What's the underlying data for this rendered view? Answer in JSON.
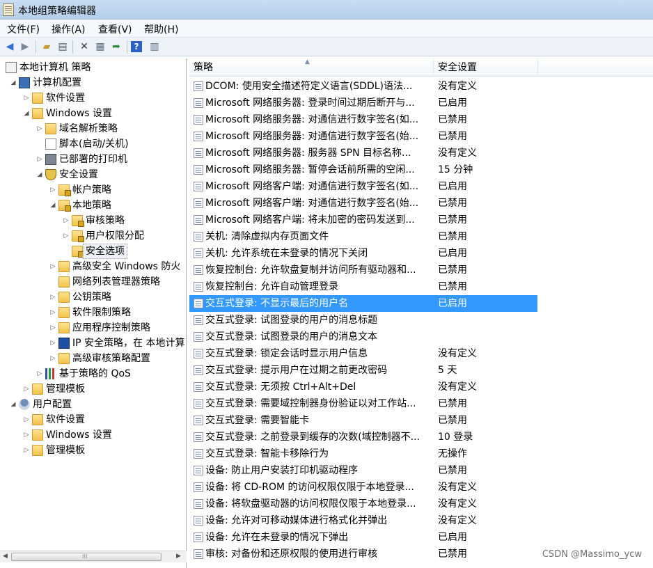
{
  "window": {
    "title": "本地组策略编辑器"
  },
  "menu": [
    "文件(F)",
    "操作(A)",
    "查看(V)",
    "帮助(H)"
  ],
  "toolbar": [
    "back-icon",
    "forward-icon",
    "up-folder-icon",
    "show-hide-tree-icon",
    "delete-icon",
    "properties-icon",
    "export-icon",
    "help-icon",
    "view-icon"
  ],
  "tree": [
    {
      "label": "本地计算机 策略",
      "icon": "root",
      "indent": 0,
      "exp": ""
    },
    {
      "label": "计算机配置",
      "icon": "pc",
      "indent": 1,
      "exp": "◢"
    },
    {
      "label": "软件设置",
      "icon": "folder",
      "indent": 2,
      "exp": "▷"
    },
    {
      "label": "Windows 设置",
      "icon": "folder",
      "indent": 2,
      "exp": "◢"
    },
    {
      "label": "域名解析策略",
      "icon": "folder",
      "indent": 3,
      "exp": "▷"
    },
    {
      "label": "脚本(启动/关机)",
      "icon": "doc",
      "indent": 3,
      "exp": ""
    },
    {
      "label": "已部署的打印机",
      "icon": "printer",
      "indent": 3,
      "exp": "▷"
    },
    {
      "label": "安全设置",
      "icon": "shield",
      "indent": 3,
      "exp": "◢"
    },
    {
      "label": "帐户策略",
      "icon": "folder-lock",
      "indent": 4,
      "exp": "▷"
    },
    {
      "label": "本地策略",
      "icon": "folder-lock",
      "indent": 4,
      "exp": "◢"
    },
    {
      "label": "审核策略",
      "icon": "folder-lock",
      "indent": 5,
      "exp": "▷"
    },
    {
      "label": "用户权限分配",
      "icon": "folder-lock",
      "indent": 5,
      "exp": "▷"
    },
    {
      "label": "安全选项",
      "icon": "folder-lock",
      "indent": 5,
      "exp": "",
      "selected": true
    },
    {
      "label": "高级安全 Windows 防火",
      "icon": "folder",
      "indent": 4,
      "exp": "▷"
    },
    {
      "label": "网络列表管理器策略",
      "icon": "folder",
      "indent": 4,
      "exp": ""
    },
    {
      "label": "公钥策略",
      "icon": "folder",
      "indent": 4,
      "exp": "▷"
    },
    {
      "label": "软件限制策略",
      "icon": "folder",
      "indent": 4,
      "exp": "▷"
    },
    {
      "label": "应用程序控制策略",
      "icon": "folder",
      "indent": 4,
      "exp": "▷"
    },
    {
      "label": "IP 安全策略，在 本地计算",
      "icon": "ipsec",
      "indent": 4,
      "exp": "▷"
    },
    {
      "label": "高级审核策略配置",
      "icon": "folder",
      "indent": 4,
      "exp": "▷"
    },
    {
      "label": "基于策略的 QoS",
      "icon": "bars",
      "indent": 3,
      "exp": "▷"
    },
    {
      "label": "管理模板",
      "icon": "folder",
      "indent": 2,
      "exp": "▷"
    },
    {
      "label": "用户配置",
      "icon": "user",
      "indent": 1,
      "exp": "◢"
    },
    {
      "label": "软件设置",
      "icon": "folder",
      "indent": 2,
      "exp": "▷"
    },
    {
      "label": "Windows 设置",
      "icon": "folder",
      "indent": 2,
      "exp": "▷"
    },
    {
      "label": "管理模板",
      "icon": "folder",
      "indent": 2,
      "exp": "▷"
    }
  ],
  "columns": {
    "policy": "策略",
    "setting": "安全设置"
  },
  "rows": [
    {
      "policy": "DCOM: 使用安全描述符定义语言(SDDL)语法...",
      "setting": "没有定义"
    },
    {
      "policy": "Microsoft 网络服务器: 登录时间过期后断开与...",
      "setting": "已启用"
    },
    {
      "policy": "Microsoft 网络服务器: 对通信进行数字签名(如...",
      "setting": "已禁用"
    },
    {
      "policy": "Microsoft 网络服务器: 对通信进行数字签名(始...",
      "setting": "已禁用"
    },
    {
      "policy": "Microsoft 网络服务器: 服务器 SPN 目标名称...",
      "setting": "没有定义"
    },
    {
      "policy": "Microsoft 网络服务器: 暂停会话前所需的空闲...",
      "setting": "15 分钟"
    },
    {
      "policy": "Microsoft 网络客户端: 对通信进行数字签名(如...",
      "setting": "已启用"
    },
    {
      "policy": "Microsoft 网络客户端: 对通信进行数字签名(始...",
      "setting": "已禁用"
    },
    {
      "policy": "Microsoft 网络客户端: 将未加密的密码发送到...",
      "setting": "已禁用"
    },
    {
      "policy": "关机: 清除虚拟内存页面文件",
      "setting": "已禁用"
    },
    {
      "policy": "关机: 允许系统在未登录的情况下关闭",
      "setting": "已启用"
    },
    {
      "policy": "恢复控制台: 允许软盘复制并访问所有驱动器和...",
      "setting": "已禁用"
    },
    {
      "policy": "恢复控制台: 允许自动管理登录",
      "setting": "已禁用"
    },
    {
      "policy": "交互式登录: 不显示最后的用户名",
      "setting": "已启用",
      "selected": true
    },
    {
      "policy": "交互式登录: 试图登录的用户的消息标题",
      "setting": ""
    },
    {
      "policy": "交互式登录: 试图登录的用户的消息文本",
      "setting": ""
    },
    {
      "policy": "交互式登录: 锁定会话时显示用户信息",
      "setting": "没有定义"
    },
    {
      "policy": "交互式登录: 提示用户在过期之前更改密码",
      "setting": "5 天"
    },
    {
      "policy": "交互式登录: 无须按 Ctrl+Alt+Del",
      "setting": "没有定义"
    },
    {
      "policy": "交互式登录: 需要域控制器身份验证以对工作站...",
      "setting": "已禁用"
    },
    {
      "policy": "交互式登录: 需要智能卡",
      "setting": "已禁用"
    },
    {
      "policy": "交互式登录: 之前登录到缓存的次数(域控制器不...",
      "setting": "10 登录"
    },
    {
      "policy": "交互式登录: 智能卡移除行为",
      "setting": "无操作"
    },
    {
      "policy": "设备: 防止用户安装打印机驱动程序",
      "setting": "已禁用"
    },
    {
      "policy": "设备: 将 CD-ROM 的访问权限仅限于本地登录...",
      "setting": "没有定义"
    },
    {
      "policy": "设备: 将软盘驱动器的访问权限仅限于本地登录...",
      "setting": "没有定义"
    },
    {
      "policy": "设备: 允许对可移动媒体进行格式化并弹出",
      "setting": "没有定义"
    },
    {
      "policy": "设备: 允许在未登录的情况下弹出",
      "setting": "已启用"
    },
    {
      "policy": "审核: 对备份和还原权限的使用进行审核",
      "setting": "已禁用"
    }
  ],
  "watermark": "CSDN @Massimo_ycw"
}
